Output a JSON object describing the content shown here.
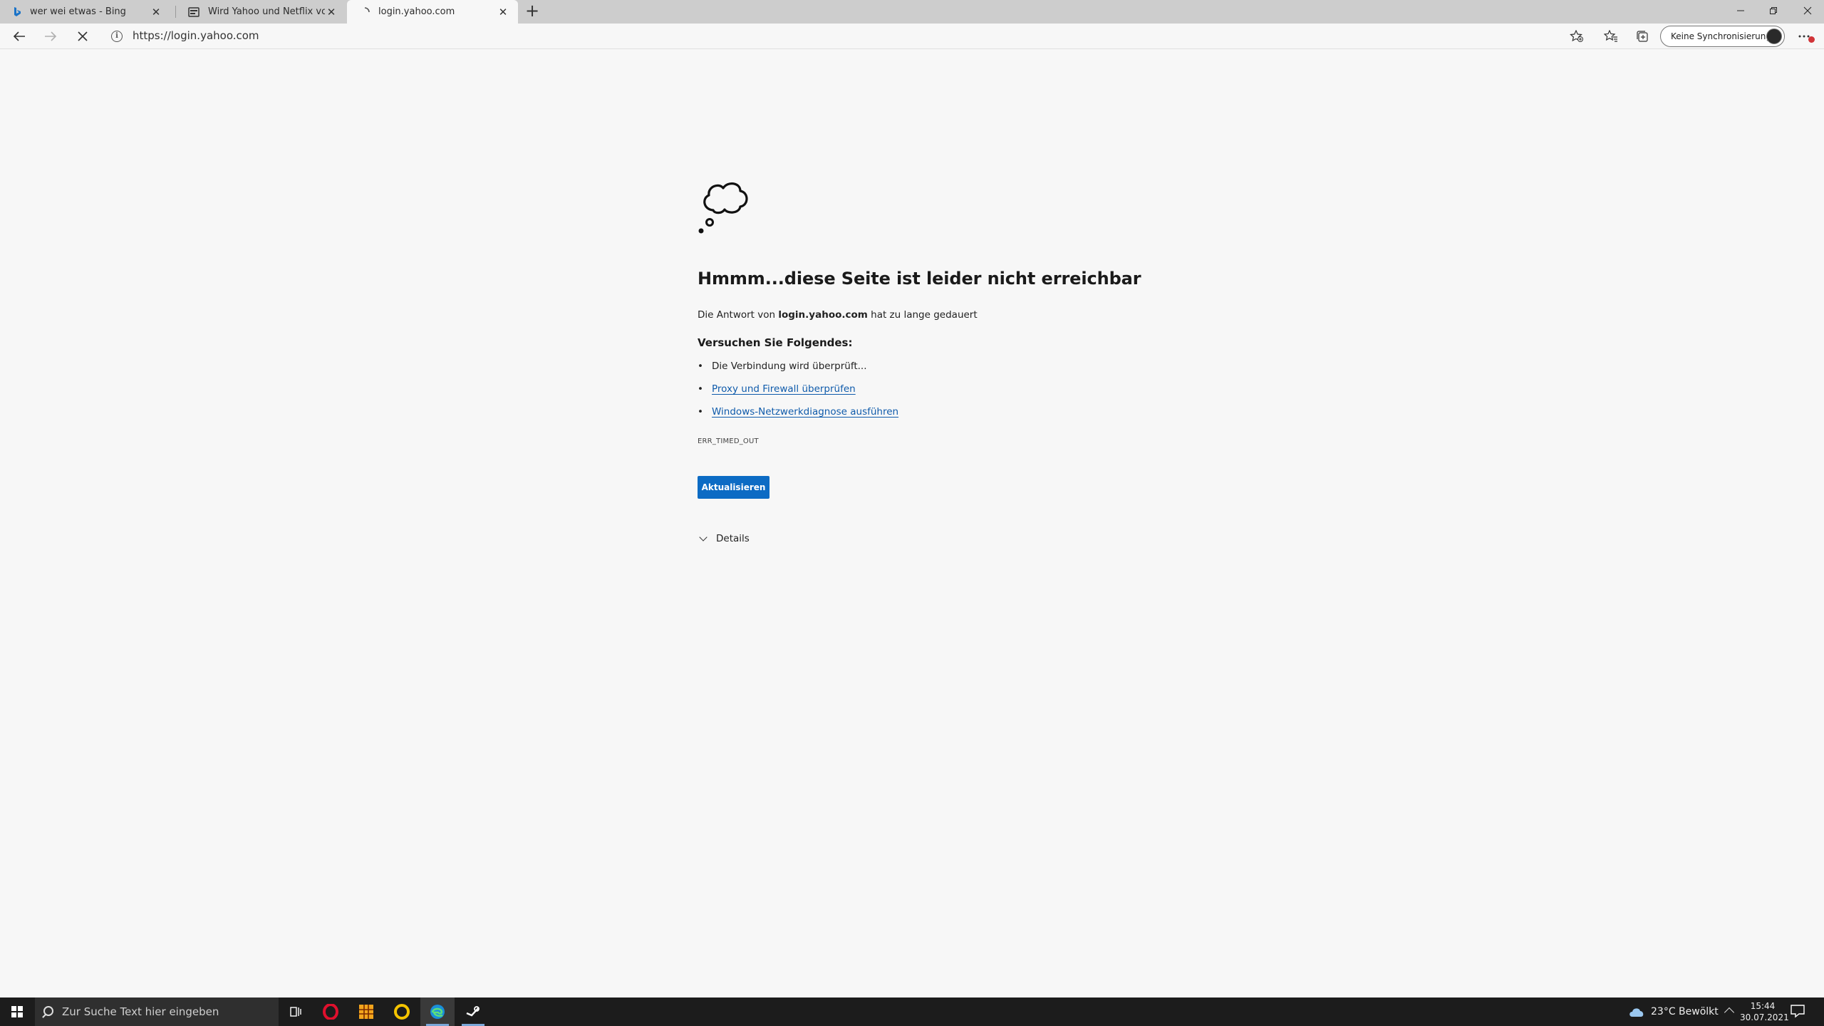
{
  "tabs": [
    {
      "title": "wer wei etwas - Bing",
      "icon": "bing-icon"
    },
    {
      "title": "Wird Yahoo und Netflix von Wind",
      "icon": "document-icon"
    },
    {
      "title": "login.yahoo.com",
      "icon": "loading-icon"
    }
  ],
  "new_tab_label": "+",
  "toolbar": {
    "url": "https://login.yahoo.com",
    "sync_label": "Keine Synchronisierung"
  },
  "error": {
    "title": "Hmmm...diese Seite ist leider nicht erreichbar",
    "desc_prefix": "Die Antwort von ",
    "desc_host": "login.yahoo.com",
    "desc_suffix": " hat zu lange gedauert",
    "try_heading": "Versuchen Sie Folgendes:",
    "suggestion_1": "Die Verbindung wird überprüft...",
    "suggestion_2": "Proxy und Firewall überprüfen",
    "suggestion_3": "Windows-Netzwerkdiagnose ausführen",
    "code": "ERR_TIMED_OUT",
    "reload_label": "Aktualisieren",
    "details_label": "Details"
  },
  "taskbar": {
    "search_placeholder": "Zur Suche Text hier eingeben",
    "weather": "23°C  Bewölkt",
    "time": "15:44",
    "date": "30.07.2021"
  },
  "colors": {
    "accent": "#0c6bc4",
    "link": "#0f5bab",
    "taskbar": "#1c1c1c",
    "tabstrip": "#cdcdcd"
  }
}
